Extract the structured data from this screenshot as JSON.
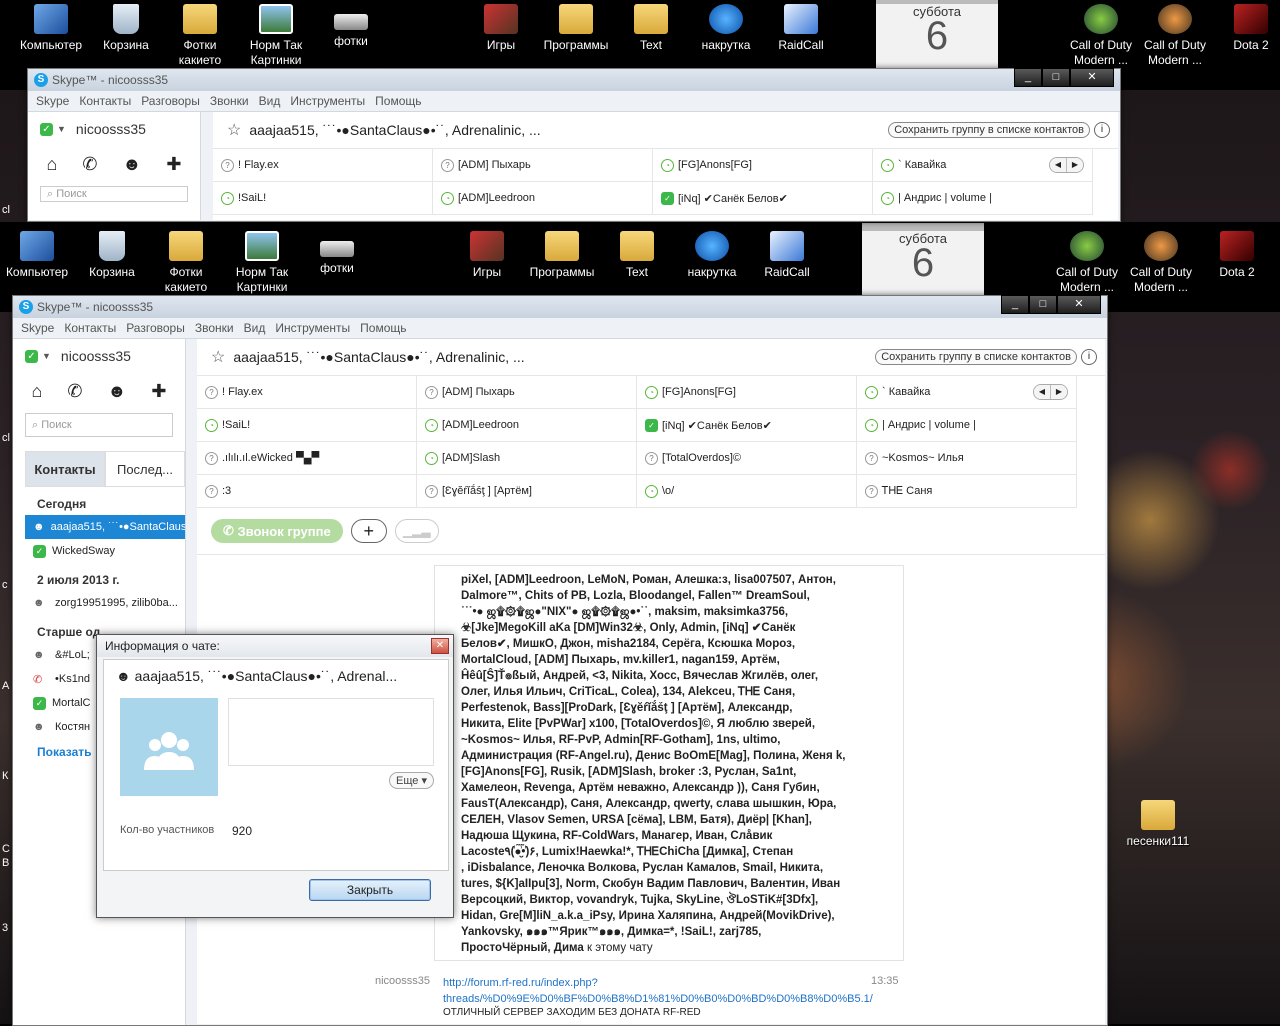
{
  "desktop": {
    "icons_left": [
      {
        "label": "Компьютер",
        "icon": "computer-icon"
      },
      {
        "label": "Корзина",
        "icon": "recycle-bin-icon"
      },
      {
        "label": "Фотки какието",
        "icon": "folder-icon"
      },
      {
        "label": "Норм Так Картинки",
        "icon": "picture-icon"
      },
      {
        "label": "фотки",
        "icon": "drive-icon"
      }
    ],
    "icons_mid": [
      {
        "label": "Игры",
        "icon": "games-folder-icon"
      },
      {
        "label": "Программы",
        "icon": "folder-icon"
      },
      {
        "label": "Text",
        "icon": "folder-icon"
      },
      {
        "label": "накрутка",
        "icon": "quicktime-icon"
      },
      {
        "label": "RaidCall",
        "icon": "raidcall-icon"
      }
    ],
    "icons_right": [
      {
        "label": "Call of Duty Modern ...",
        "icon": "cod-icon"
      },
      {
        "label": "Call of Duty Modern ...",
        "icon": "cod2-icon"
      },
      {
        "label": "Dota 2",
        "icon": "dota-icon"
      }
    ],
    "calendar": {
      "day_name": "суббота",
      "day_number": "6"
    },
    "side_folder": {
      "label": "песенки111",
      "icon": "folder-icon"
    },
    "left_edge_chars": [
      "cl",
      "cl",
      "с",
      "А",
      "К",
      "С",
      "В",
      "3"
    ]
  },
  "skype": {
    "title": "Skype™ - nicoosss35",
    "menu": [
      "Skype",
      "Контакты",
      "Разговоры",
      "Звонки",
      "Вид",
      "Инструменты",
      "Помощь"
    ],
    "user": "nicoosss35",
    "search_placeholder": "Поиск",
    "tabs": {
      "contacts": "Контакты",
      "recent": "Послед..."
    },
    "sections": {
      "today": "Сегодня",
      "date": "2 июля 2013 г.",
      "older": "Старше од"
    },
    "recent_items": {
      "today": [
        {
          "label": "aaajaa515, ˙˙˙•●SantaClaus●•˙˙, Adrenalinic, ...",
          "selected": true,
          "icon": "group-icon"
        },
        {
          "label": "WickedSway",
          "selected": false,
          "icon": "status-online-icon"
        }
      ],
      "date": [
        {
          "label": "zorg19951995, zilib0ba...",
          "icon": "group-icon"
        }
      ],
      "older": [
        {
          "label": "&#LoL;",
          "icon": "group-icon"
        },
        {
          "label": "•Ks1nd",
          "icon": "phone-icon"
        },
        {
          "label": "MortalC",
          "icon": "status-online-icon"
        },
        {
          "label": "Костян",
          "icon": "group-icon"
        }
      ]
    },
    "show_more": "Показать",
    "conv_title": "aaajaa515, ˙˙˙•●SantaClaus●•˙˙, Adrenalinic, ...",
    "save_group_label": "Сохранить группу в списке контактов",
    "participants": [
      {
        "name": "! Flay.ex",
        "status": "unknown"
      },
      {
        "name": "[ADM] Пыхарь",
        "status": "unknown"
      },
      {
        "name": "[FG]Anons[FG]",
        "status": "away"
      },
      {
        "name": "` Кавайка",
        "status": "away"
      },
      {
        "name": "!SaiL!",
        "status": "away"
      },
      {
        "name": "[ADM]Leedroon",
        "status": "away"
      },
      {
        "name": "[iNq] ✔Санёк Белов✔",
        "status": "online"
      },
      {
        "name": "| Андрис | volume |",
        "status": "away"
      },
      {
        "name": ".ılılı.ıl.eWicked ▀▄▀",
        "status": "unknown"
      },
      {
        "name": "[ADM]Slash",
        "status": "away"
      },
      {
        "name": "[TotalOverdos]©",
        "status": "unknown"
      },
      {
        "name": "~Kosmos~ Илья",
        "status": "unknown"
      },
      {
        "name": ":3",
        "status": "unknown"
      },
      {
        "name": "[Ɛɣĕŕĭắṥţ ] [Артём]",
        "status": "unknown"
      },
      {
        "name": "\\o/",
        "status": "away"
      },
      {
        "name": "ᎢᎻᎬ Саня",
        "status": "unknown"
      }
    ],
    "call_group_label": "Звонок группе",
    "message_lines": [
      "piXel, [ADM]Leedroon, LeMoN, Роман, Алешка:з, lisa007507, Антон,",
      "Dalmore™, Chits of PB, Lozla, Bloodangel, Fallen™   DreamSoul,",
      "˙˙˙•● ஜ۩۞۩ஜ●\"NIX\"● ஜ۩۞۩ஜ●•˙˙, maksim, maksimka3756,",
      "☣[Jke]MegoKill aKa [DM]Win32☣, Only, Admin, [iNq] ✔Санёк",
      "Белов✔, МишкО, Джон, misha2184, Серёга, Ксюшка Мороз,",
      "MortalCloud, [ADM] Пыхарь, mv.killer1, nagan159, Артём,",
      "Ĥêû[Ŝ]Ť๏ßьıй, Андрей, <3, Nikita, Хосс, Вячеслав Жгилёв, олег,",
      "Олег, Илья Ильич, CriTicaL, Colea), 134, Alekceu, ᎢᎻᎬ Саня,",
      "Perfestenok, Bass][ProDark, [Ɛɣĕŕĭắṥţ ] [Артём], Александр,",
      "Никита, Elite [PvPWar] x100, [TotalOverdos]©, Я люблю зверей,",
      "~Kosmos~ Илья, RF-PvP, Admin[RF-Gotham], 1ns, ultimo,",
      "Администрация (RF-Angel.ru), Денис BoOmE[Mag], Полина, Женя k,",
      "[FG]Anons[FG], Rusik, [ADM]Slash, broker :3, Руслан, Sa1nt,",
      "Хамелеон, Revenga, Артём неважно, Александр )), Саня Губин,",
      "FausT(Александр), Саня, Александр, qwerty, слава  шышкин, Юра,",
      "СЕЛЕН, Vlasov Semen, URSA [сёма], LBM, Батя), Диёр| [Khan],",
      "Надюша Щукина, RF-ColdWars, Манагер, Иван, Слåвик",
      "Lacoste٩(̾●̮̮̃̾•̃̾)۶, Lumix!Haewka!*, ᎢᎻᎬChiCha [Димка], Степан",
      ", iDisbalance, Леночка Волкова, Руслан Камалов, Smail, Никита,",
      "tures, ${K]aIIpu[3], Norm, Скобун Вадим Павлович, Валентин, Иван",
      "Версоцкий, Виктор, vovandryk, Tujka, SkyLine, ঔLoSTiK#[3Dfx],",
      "Hidan, Gre[M]liN_a.k.a_iPsy, Ирина Халяпина, Андрей(MovikDrive),",
      "Yankovsky, ๑๑๑™Ярик™๑๑๑, Димка=*, !SaiL!, zarj785,"
    ],
    "message_last_bold": "ПростоЧёрный, Дима",
    "message_last_normal": " к этому чату",
    "next_msg": {
      "sender": "nicoosss35",
      "time": "13:35",
      "link": "http://forum.rf-red.ru/index.php?threads/%D0%9E%D0%BF%D0%B8%D1%81%D0%B0%D0%BD%D0%B8%D0%B5.1/",
      "text": "ОТЛИЧНЫЙ СЕРВЕР ЗАХОДИМ БЕЗ ДОНАТА RF-RED"
    }
  },
  "dialog": {
    "title": "Информация о чате:",
    "chat_name": "aaajaa515, ˙˙˙•●SantaClaus●•˙˙, Adrenal...",
    "more_label": "Еще ▾",
    "participants_label": "Кол-во участников",
    "participants_count": "920",
    "close_label": "Закрыть"
  }
}
